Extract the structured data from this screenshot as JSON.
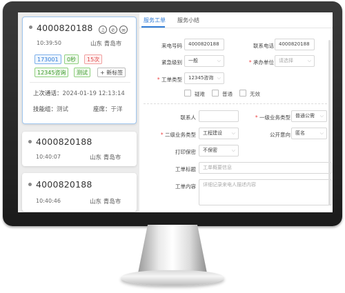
{
  "calls": [
    {
      "phone": "4000820188",
      "time": "10:39:50",
      "location": "山东 青岛市",
      "action_icons": [
        "headset-icon",
        "phone-icon",
        "mail-icon"
      ],
      "tags": [
        "173001",
        "0秒",
        "15次",
        "12345咨询",
        "测试"
      ],
      "add_tag_label": "+ 新标签",
      "last_call_label": "上次通话：",
      "last_call_time": "2024-01-19 12:13:14",
      "skill_group_label": "技能组：",
      "skill_group_value": "测试",
      "seat_label": "座席：",
      "seat_value": "于洋"
    },
    {
      "phone": "4000820188",
      "time": "10:40:07",
      "location": "山东 青岛市"
    },
    {
      "phone": "4000820188",
      "time": "10:40:46",
      "location": "山东 青岛市"
    }
  ],
  "tabs": [
    "服务工单",
    "服务小结"
  ],
  "form": {
    "caller_number_label": "来电号码",
    "caller_number_value": "4000820188",
    "contact_phone_label": "联系电话",
    "contact_phone_value": "4000820188",
    "urgency_label": "紧急级别",
    "urgency_value": "一般",
    "handling_unit_label": "承办单位",
    "handling_unit_placeholder": "请选择",
    "ticket_type_label": "工单类型",
    "ticket_type_value": "12345咨询",
    "checkbox_options": [
      "疑难",
      "普通",
      "无效"
    ],
    "contact_person_label": "联系人",
    "biz_type1_label": "一级业务类型",
    "biz_type1_value": "普通公需",
    "biz_type2_label": "二级业务类型",
    "biz_type2_value": "工程建设",
    "public_intent_label": "公开意向",
    "public_intent_value": "匿名",
    "confidential_label": "打印保密",
    "confidential_value": "不保密",
    "title_label": "工单标题",
    "title_placeholder": "工单概要信息",
    "content_label": "工单内容",
    "content_placeholder": "详细记录来电人描述内容"
  },
  "colors": {
    "accent": "#2f7bd6",
    "required": "#e44444",
    "bezel": "#1f1f1f"
  }
}
